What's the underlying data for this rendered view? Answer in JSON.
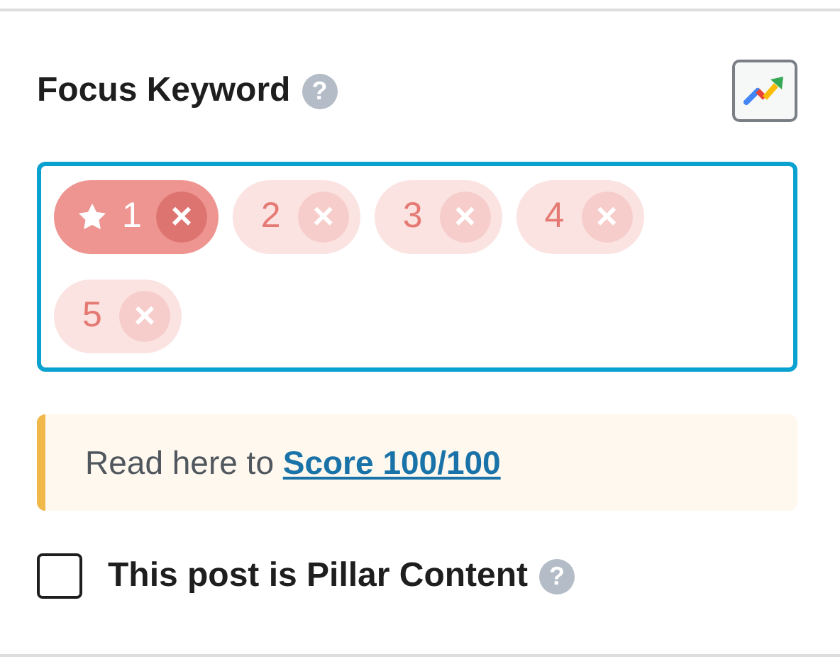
{
  "heading": {
    "label": "Focus Keyword",
    "help": "?"
  },
  "keywords": [
    {
      "label": "1",
      "primary": true,
      "remove": "×"
    },
    {
      "label": "2",
      "primary": false,
      "remove": "×"
    },
    {
      "label": "3",
      "primary": false,
      "remove": "×"
    },
    {
      "label": "4",
      "primary": false,
      "remove": "×"
    },
    {
      "label": "5",
      "primary": false,
      "remove": "×"
    }
  ],
  "notice": {
    "text": "Read here to ",
    "link": "Score 100/100"
  },
  "pillar": {
    "label": "This post is Pillar Content",
    "checked": false,
    "help": "?"
  }
}
